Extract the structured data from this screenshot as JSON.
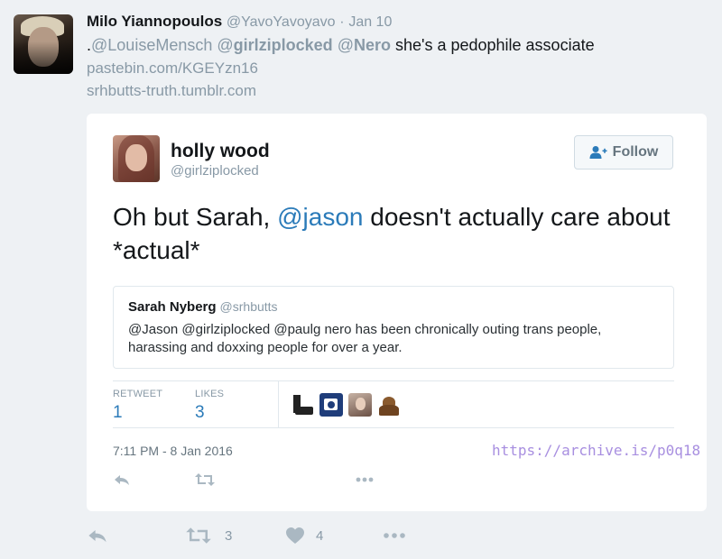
{
  "tweet": {
    "author_name": "Milo Yiannopoulos",
    "author_handle": "@YavoYavoyavo",
    "separator": "·",
    "date": "Jan 10",
    "text_prefix": ".",
    "mention1": "@LouiseMensch",
    "mention2_at": "@",
    "mention2_name": "girlziplocked",
    "mention3_at": "@",
    "mention3_name": "Nero",
    "text_body": " she's a pedophile associate",
    "link1": "pastebin.com/KGEYzn16",
    "link2": "srhbutts-truth.tumblr.com",
    "retweet_count": "3",
    "like_count": "4"
  },
  "embedded": {
    "author_name": "holly wood",
    "author_handle": "@girlziplocked",
    "follow_label": "Follow",
    "text_before": "Oh but Sarah, ",
    "text_mention": "@jason",
    "text_after": " doesn't actually care about *actual*",
    "quote": {
      "author_name": "Sarah Nyberg",
      "author_handle": "@srhbutts",
      "text": "@Jason @girlziplocked @paulg nero has been chronically outing trans people, harassing and doxxing people for over a year."
    },
    "stats": {
      "retweet_label": "RETWEET",
      "retweet_value": "1",
      "likes_label": "LIKES",
      "likes_value": "3"
    },
    "timestamp": "7:11 PM - 8 Jan 2016",
    "archive_link": "https://archive.is/p0q18"
  },
  "icons": [
    "reply-icon",
    "retweet-icon",
    "like-icon",
    "more-icon",
    "follow-person-plus-icon"
  ],
  "colors": {
    "link_blue": "#2b7bb9",
    "muted_gray": "#8899a6",
    "archive_purple": "#a88fe0",
    "background": "#eef1f4"
  }
}
